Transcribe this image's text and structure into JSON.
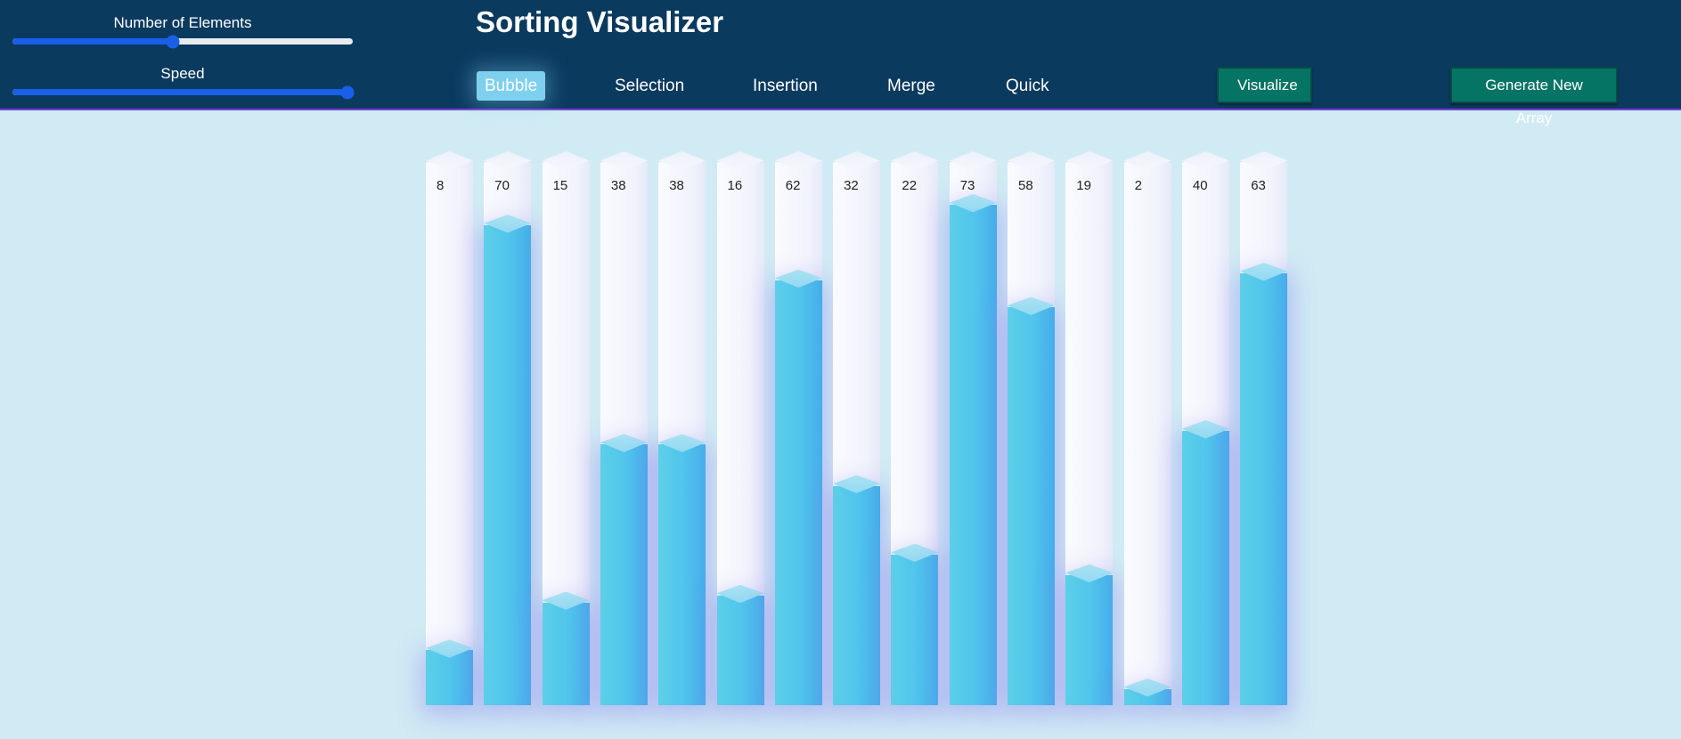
{
  "controls": {
    "elements": {
      "label": "Number of Elements",
      "value_fraction": 0.47
    },
    "speed": {
      "label": "Speed",
      "value_fraction": 0.985
    }
  },
  "header": {
    "title": "Sorting Visualizer"
  },
  "tabs": [
    {
      "label": "Bubble",
      "active": true
    },
    {
      "label": "Selection",
      "active": false
    },
    {
      "label": "Insertion",
      "active": false
    },
    {
      "label": "Merge",
      "active": false
    },
    {
      "label": "Quick",
      "active": false
    }
  ],
  "actions": {
    "visualize": "Visualize",
    "generate": "Generate New Array"
  },
  "array": {
    "values": [
      8,
      70,
      15,
      38,
      38,
      16,
      62,
      32,
      22,
      73,
      58,
      19,
      2,
      40,
      63
    ],
    "max_value": 73
  },
  "colors": {
    "header_bg": "#0b3a5f",
    "page_bg": "#d1ebf4",
    "bar_fill": "#50c4ec",
    "active_tab": "#7ed0ee",
    "button_bg": "#067465",
    "slider_accent": "#1a5fe8"
  }
}
